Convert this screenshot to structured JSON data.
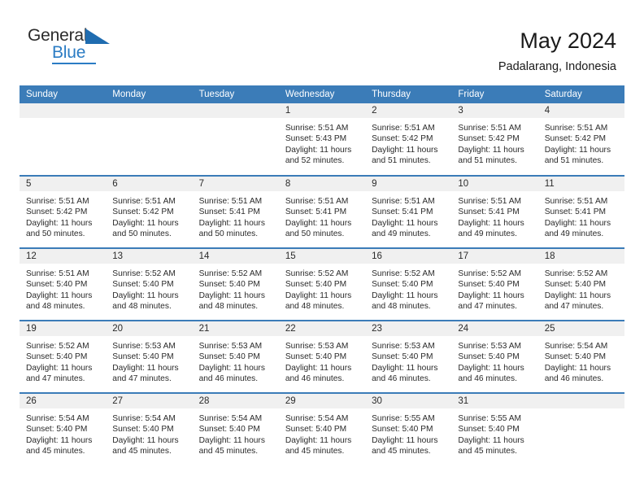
{
  "logo": {
    "word_one": "General",
    "word_two": "Blue",
    "triangle_icon": "triangle-icon",
    "accent_color": "#2b7cc4"
  },
  "header": {
    "title": "May 2024",
    "subtitle": "Padalarang, Indonesia",
    "header_bg_color": "#3b7cb8"
  },
  "weekday_headers": [
    "Sunday",
    "Monday",
    "Tuesday",
    "Wednesday",
    "Thursday",
    "Friday",
    "Saturday"
  ],
  "weeks": [
    [
      {
        "day": "",
        "details": ""
      },
      {
        "day": "",
        "details": ""
      },
      {
        "day": "",
        "details": ""
      },
      {
        "day": "1",
        "details": "Sunrise: 5:51 AM\nSunset: 5:43 PM\nDaylight: 11 hours\nand 52 minutes."
      },
      {
        "day": "2",
        "details": "Sunrise: 5:51 AM\nSunset: 5:42 PM\nDaylight: 11 hours\nand 51 minutes."
      },
      {
        "day": "3",
        "details": "Sunrise: 5:51 AM\nSunset: 5:42 PM\nDaylight: 11 hours\nand 51 minutes."
      },
      {
        "day": "4",
        "details": "Sunrise: 5:51 AM\nSunset: 5:42 PM\nDaylight: 11 hours\nand 51 minutes."
      }
    ],
    [
      {
        "day": "5",
        "details": "Sunrise: 5:51 AM\nSunset: 5:42 PM\nDaylight: 11 hours\nand 50 minutes."
      },
      {
        "day": "6",
        "details": "Sunrise: 5:51 AM\nSunset: 5:42 PM\nDaylight: 11 hours\nand 50 minutes."
      },
      {
        "day": "7",
        "details": "Sunrise: 5:51 AM\nSunset: 5:41 PM\nDaylight: 11 hours\nand 50 minutes."
      },
      {
        "day": "8",
        "details": "Sunrise: 5:51 AM\nSunset: 5:41 PM\nDaylight: 11 hours\nand 50 minutes."
      },
      {
        "day": "9",
        "details": "Sunrise: 5:51 AM\nSunset: 5:41 PM\nDaylight: 11 hours\nand 49 minutes."
      },
      {
        "day": "10",
        "details": "Sunrise: 5:51 AM\nSunset: 5:41 PM\nDaylight: 11 hours\nand 49 minutes."
      },
      {
        "day": "11",
        "details": "Sunrise: 5:51 AM\nSunset: 5:41 PM\nDaylight: 11 hours\nand 49 minutes."
      }
    ],
    [
      {
        "day": "12",
        "details": "Sunrise: 5:51 AM\nSunset: 5:40 PM\nDaylight: 11 hours\nand 48 minutes."
      },
      {
        "day": "13",
        "details": "Sunrise: 5:52 AM\nSunset: 5:40 PM\nDaylight: 11 hours\nand 48 minutes."
      },
      {
        "day": "14",
        "details": "Sunrise: 5:52 AM\nSunset: 5:40 PM\nDaylight: 11 hours\nand 48 minutes."
      },
      {
        "day": "15",
        "details": "Sunrise: 5:52 AM\nSunset: 5:40 PM\nDaylight: 11 hours\nand 48 minutes."
      },
      {
        "day": "16",
        "details": "Sunrise: 5:52 AM\nSunset: 5:40 PM\nDaylight: 11 hours\nand 48 minutes."
      },
      {
        "day": "17",
        "details": "Sunrise: 5:52 AM\nSunset: 5:40 PM\nDaylight: 11 hours\nand 47 minutes."
      },
      {
        "day": "18",
        "details": "Sunrise: 5:52 AM\nSunset: 5:40 PM\nDaylight: 11 hours\nand 47 minutes."
      }
    ],
    [
      {
        "day": "19",
        "details": "Sunrise: 5:52 AM\nSunset: 5:40 PM\nDaylight: 11 hours\nand 47 minutes."
      },
      {
        "day": "20",
        "details": "Sunrise: 5:53 AM\nSunset: 5:40 PM\nDaylight: 11 hours\nand 47 minutes."
      },
      {
        "day": "21",
        "details": "Sunrise: 5:53 AM\nSunset: 5:40 PM\nDaylight: 11 hours\nand 46 minutes."
      },
      {
        "day": "22",
        "details": "Sunrise: 5:53 AM\nSunset: 5:40 PM\nDaylight: 11 hours\nand 46 minutes."
      },
      {
        "day": "23",
        "details": "Sunrise: 5:53 AM\nSunset: 5:40 PM\nDaylight: 11 hours\nand 46 minutes."
      },
      {
        "day": "24",
        "details": "Sunrise: 5:53 AM\nSunset: 5:40 PM\nDaylight: 11 hours\nand 46 minutes."
      },
      {
        "day": "25",
        "details": "Sunrise: 5:54 AM\nSunset: 5:40 PM\nDaylight: 11 hours\nand 46 minutes."
      }
    ],
    [
      {
        "day": "26",
        "details": "Sunrise: 5:54 AM\nSunset: 5:40 PM\nDaylight: 11 hours\nand 45 minutes."
      },
      {
        "day": "27",
        "details": "Sunrise: 5:54 AM\nSunset: 5:40 PM\nDaylight: 11 hours\nand 45 minutes."
      },
      {
        "day": "28",
        "details": "Sunrise: 5:54 AM\nSunset: 5:40 PM\nDaylight: 11 hours\nand 45 minutes."
      },
      {
        "day": "29",
        "details": "Sunrise: 5:54 AM\nSunset: 5:40 PM\nDaylight: 11 hours\nand 45 minutes."
      },
      {
        "day": "30",
        "details": "Sunrise: 5:55 AM\nSunset: 5:40 PM\nDaylight: 11 hours\nand 45 minutes."
      },
      {
        "day": "31",
        "details": "Sunrise: 5:55 AM\nSunset: 5:40 PM\nDaylight: 11 hours\nand 45 minutes."
      },
      {
        "day": "",
        "details": ""
      }
    ]
  ]
}
